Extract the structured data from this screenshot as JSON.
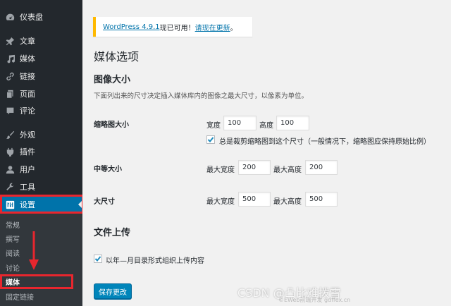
{
  "sidebar": {
    "items": [
      {
        "label": "仪表盘",
        "icon": "dashboard-icon"
      },
      {
        "label": "文章",
        "icon": "pin-icon"
      },
      {
        "label": "媒体",
        "icon": "media-icon"
      },
      {
        "label": "链接",
        "icon": "link-icon"
      },
      {
        "label": "页面",
        "icon": "page-icon"
      },
      {
        "label": "评论",
        "icon": "comment-icon"
      },
      {
        "label": "外观",
        "icon": "brush-icon"
      },
      {
        "label": "插件",
        "icon": "plugin-icon"
      },
      {
        "label": "用户",
        "icon": "user-icon"
      },
      {
        "label": "工具",
        "icon": "wrench-icon"
      },
      {
        "label": "设置",
        "icon": "settings-icon"
      }
    ],
    "submenu": [
      "常规",
      "撰写",
      "阅读",
      "讨论",
      "媒体",
      "固定链接"
    ]
  },
  "notice": {
    "link1": "WordPress 4.9.1",
    "text": "现已可用！",
    "link2": "请现在更新",
    "end": "。"
  },
  "page": {
    "title": "媒体选项",
    "section_image_sizes": "图像大小",
    "description": "下面列出来的尺寸决定插入媒体库内的图像之最大尺寸，以像素为单位。",
    "thumbnail": {
      "label": "缩略图大小",
      "width_label": "宽度",
      "width": "100",
      "height_label": "高度",
      "height": "100",
      "crop_label": "总是裁剪缩略图到这个尺寸（一般情况下，缩略图应保持原始比例）",
      "crop_checked": true
    },
    "medium": {
      "label": "中等大小",
      "width_label": "最大宽度",
      "width": "200",
      "height_label": "最大高度",
      "height": "200"
    },
    "large": {
      "label": "大尺寸",
      "width_label": "最大宽度",
      "width": "500",
      "height_label": "最大高度",
      "height": "500"
    },
    "section_uploads": "文件上传",
    "uploads_label": "以年—月目录形式组织上传内容",
    "uploads_checked": true,
    "save_button": "保存更改"
  },
  "watermark": {
    "main": "CSDN @凸比难拨雪",
    "sub": "©EWeb前端开发 gdffex.cn"
  },
  "colors": {
    "sidebar_bg": "#23282d",
    "submenu_bg": "#32373c",
    "active_bg": "#0073aa",
    "notice_border": "#ffb900",
    "button_bg": "#0085ba",
    "annotation_red": "#e8262e"
  }
}
